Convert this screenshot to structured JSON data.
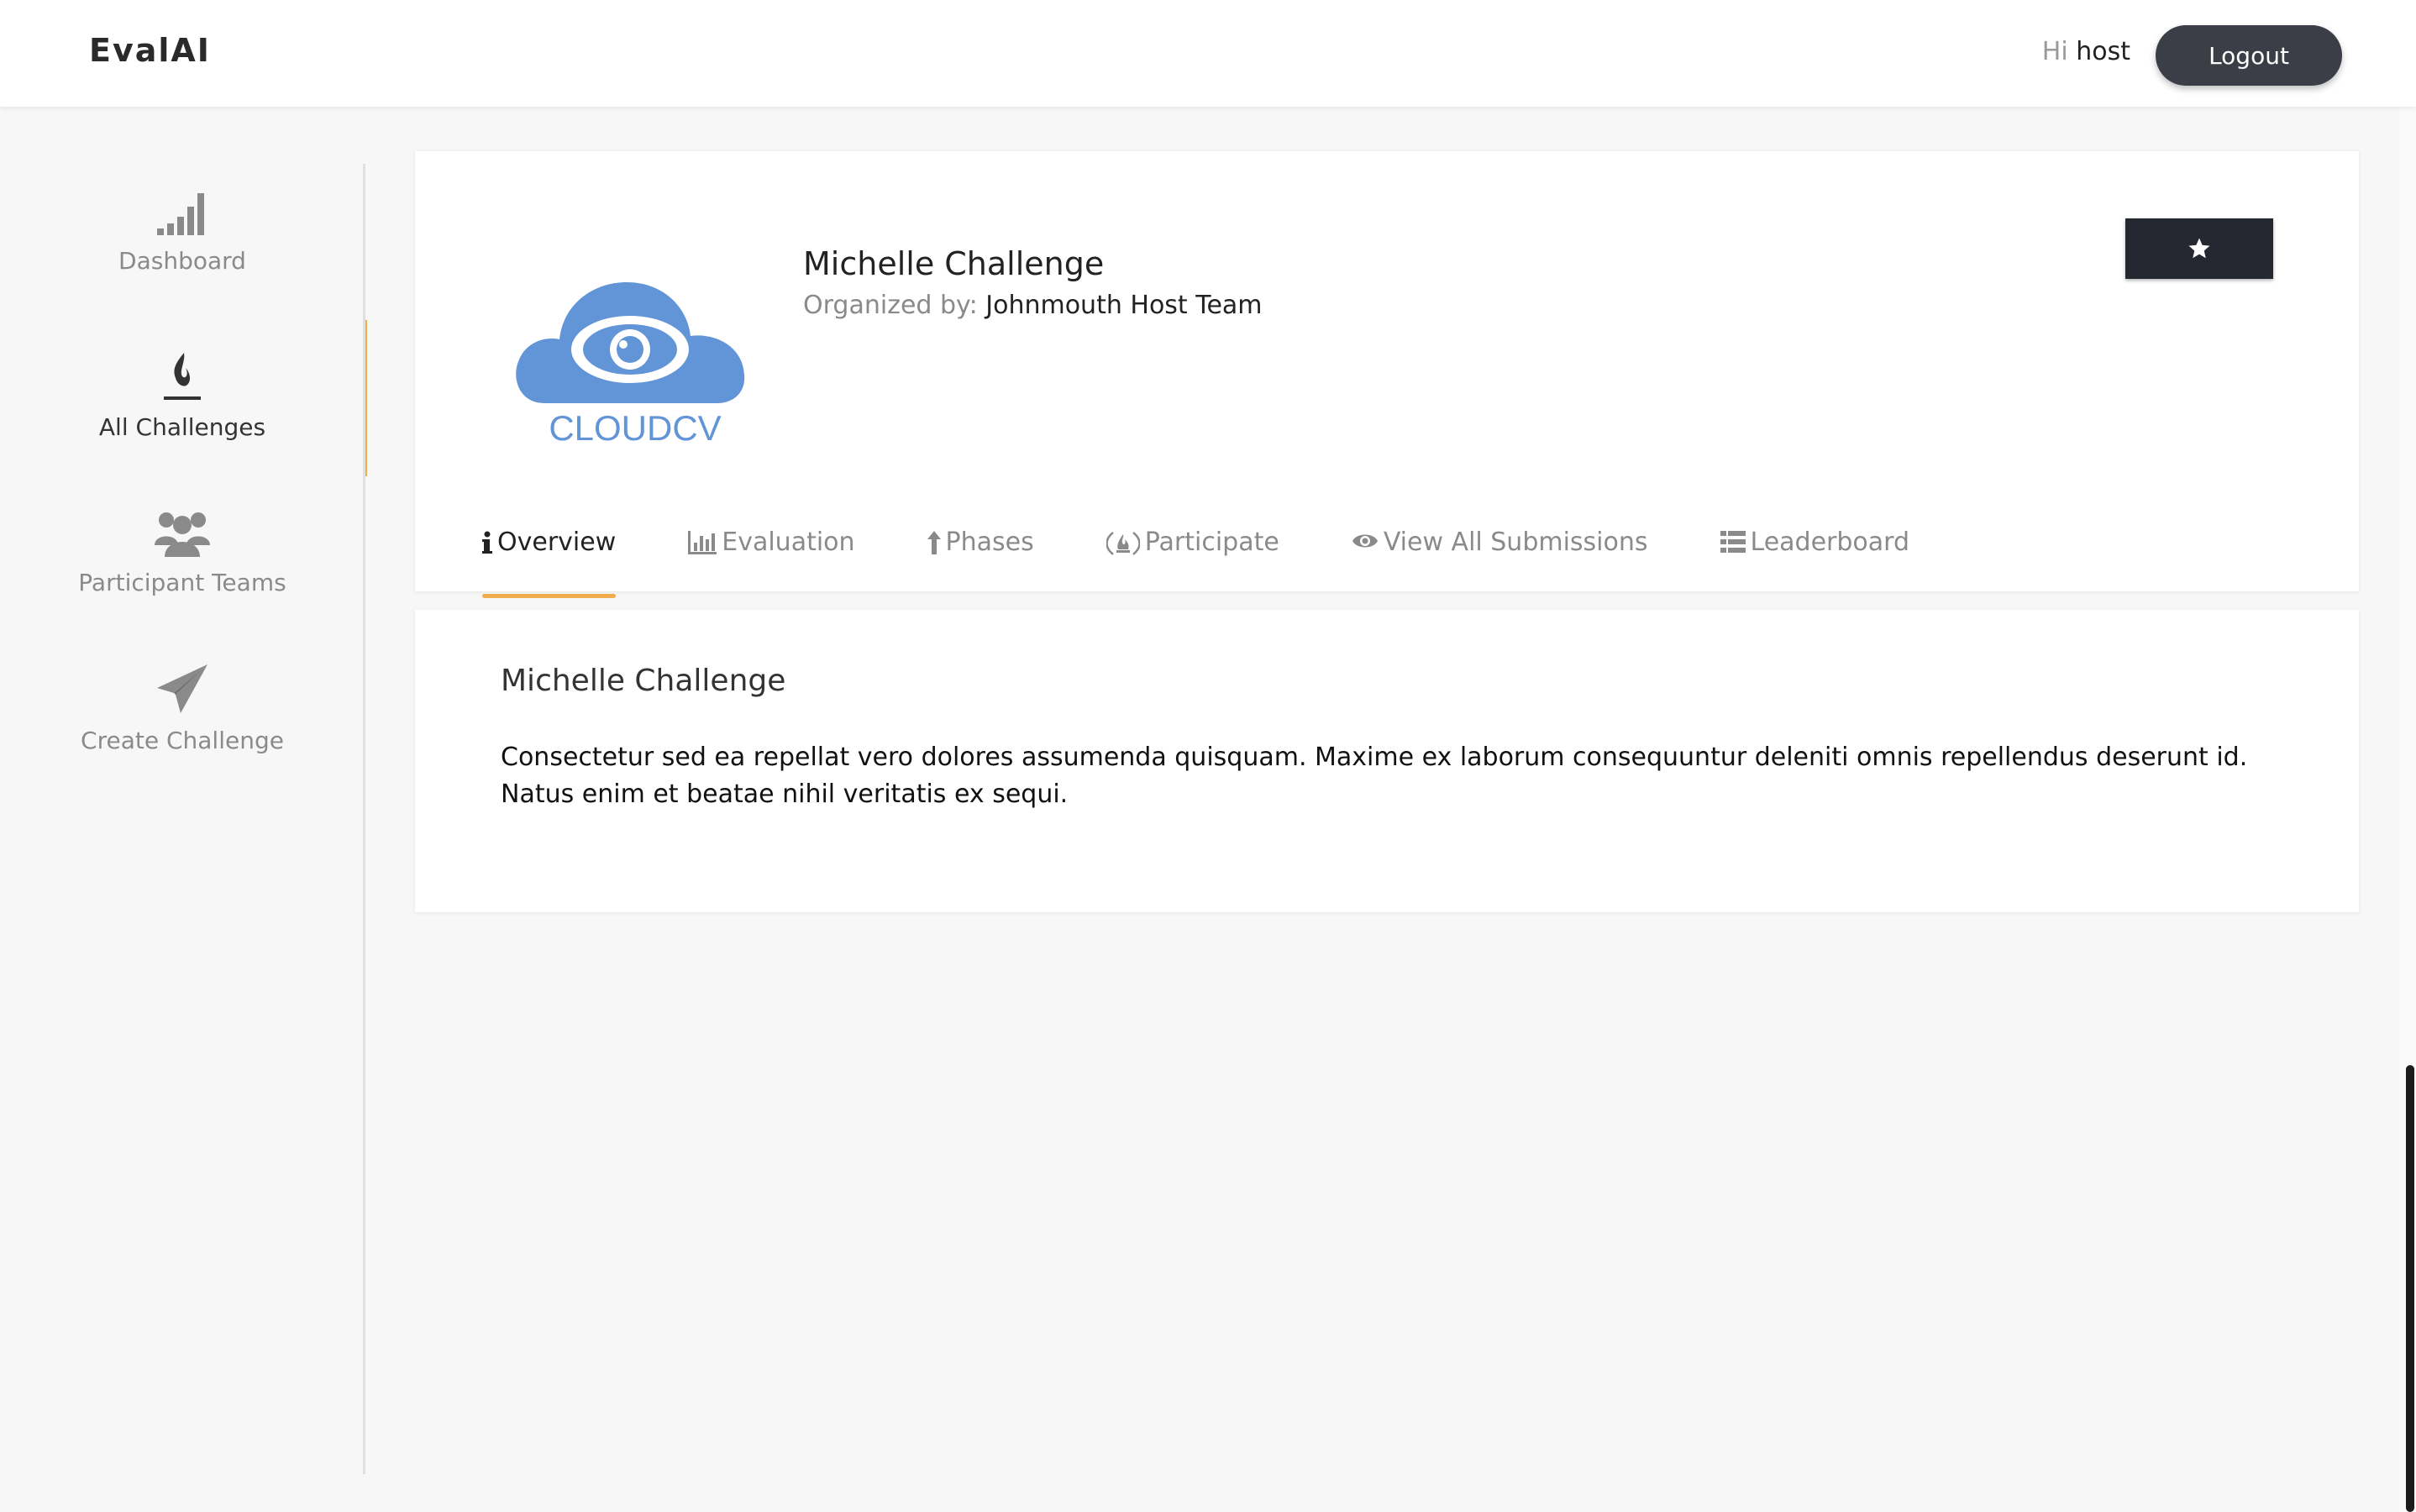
{
  "header": {
    "brand": "EvalAI",
    "greeting": "Hi",
    "username": "host",
    "logout_label": "Logout"
  },
  "sidebar": {
    "items": [
      {
        "label": "Dashboard",
        "icon": "signal-bars-icon",
        "active": false
      },
      {
        "label": "All Challenges",
        "icon": "flame-icon",
        "active": true
      },
      {
        "label": "Participant Teams",
        "icon": "users-icon",
        "active": false
      },
      {
        "label": "Create Challenge",
        "icon": "paper-plane-icon",
        "active": false
      }
    ]
  },
  "challenge": {
    "title": "Michelle Challenge",
    "organized_by_label": "Organized by:",
    "organizer": "Johnmouth Host Team",
    "logo_text": "CLOUDCV",
    "star_icon": "star-icon"
  },
  "tabs": [
    {
      "label": "Overview",
      "icon": "info-icon",
      "active": true
    },
    {
      "label": "Evaluation",
      "icon": "bar-chart-icon",
      "active": false
    },
    {
      "label": "Phases",
      "icon": "arrow-up-icon",
      "active": false
    },
    {
      "label": "Participate",
      "icon": "fire-circle-icon",
      "active": false
    },
    {
      "label": "View All Submissions",
      "icon": "eye-icon",
      "active": false
    },
    {
      "label": "Leaderboard",
      "icon": "list-icon",
      "active": false
    }
  ],
  "overview": {
    "title": "Michelle Challenge",
    "description": "Consectetur sed ea repellat vero dolores assumenda quisquam. Maxime ex laborum consequuntur deleniti omnis repellendus deserunt id. Natus enim et beatae nihil veritatis ex sequi."
  },
  "colors": {
    "accent": "#f0ad4e",
    "dark_button": "#252831",
    "logo_blue": "#6294d8"
  }
}
